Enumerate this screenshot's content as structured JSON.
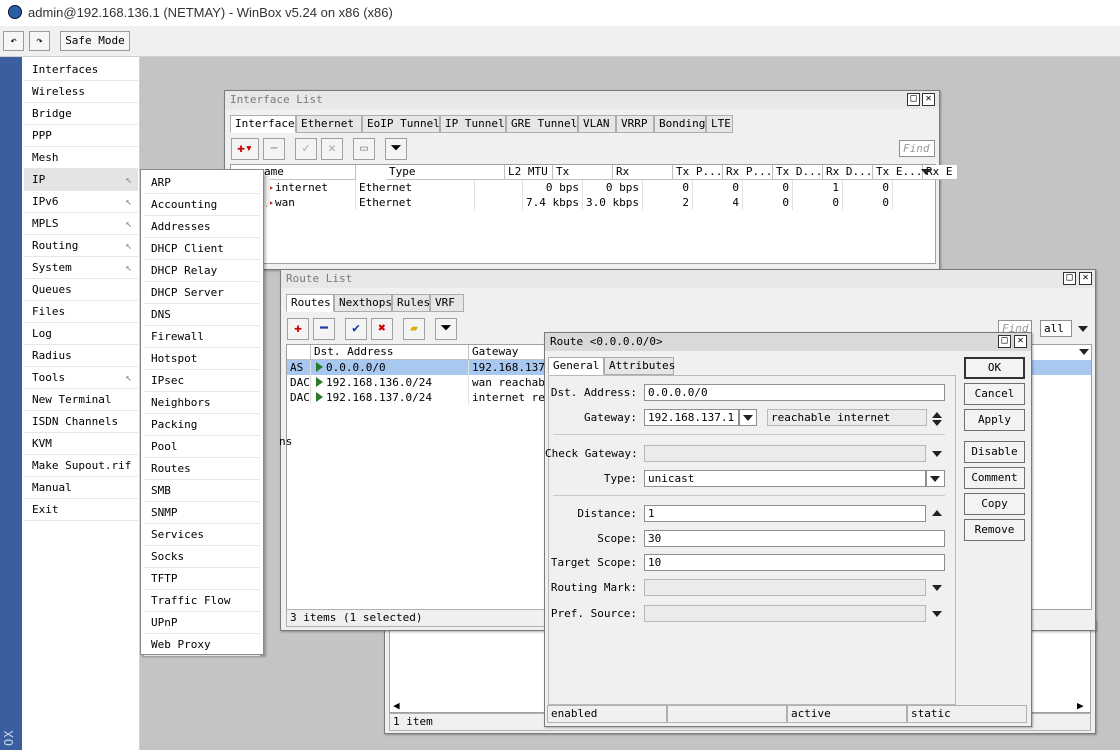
{
  "window_title": "admin@192.168.136.1 (NETMAY) - WinBox v5.24 on x86 (x86)",
  "toolbar": {
    "safe_mode": "Safe Mode"
  },
  "side_brand": "OX",
  "main_menu": [
    "Interfaces",
    "Wireless",
    "Bridge",
    "PPP",
    "Mesh",
    "IP",
    "IPv6",
    "MPLS",
    "Routing",
    "System",
    "Queues",
    "Files",
    "Log",
    "Radius",
    "Tools",
    "New Terminal",
    "ISDN Channels",
    "KVM",
    "Make Supout.rif",
    "Manual",
    "Exit"
  ],
  "ip_submenu": [
    "ARP",
    "Accounting",
    "Addresses",
    "DHCP Client",
    "DHCP Relay",
    "DHCP Server",
    "DNS",
    "Firewall",
    "Hotspot",
    "IPsec",
    "Neighbors",
    "Packing",
    "Pool",
    "Routes",
    "SMB",
    "SNMP",
    "Services",
    "Socks",
    "TFTP",
    "Traffic Flow",
    "UPnP",
    "Web Proxy"
  ],
  "interface_list": {
    "title": "Interface List",
    "tabs": [
      "Interface",
      "Ethernet",
      "EoIP Tunnel",
      "IP Tunnel",
      "GRE Tunnel",
      "VLAN",
      "VRRP",
      "Bonding",
      "LTE"
    ],
    "find": "Find",
    "columns": [
      "ame",
      "Type",
      "L2 MTU",
      "Tx",
      "Rx",
      "Tx P...",
      "Rx P...",
      "Tx D...",
      "Rx D...",
      "Tx E...",
      "Rx E"
    ],
    "rows": [
      [
        "internet",
        "Ethernet",
        "",
        "0 bps",
        "0 bps",
        "0",
        "0",
        "0",
        "1",
        "0"
      ],
      [
        "wan",
        "Ethernet",
        "",
        "7.4 kbps",
        "3.0 kbps",
        "2",
        "4",
        "0",
        "0",
        "0"
      ]
    ],
    "status": "1 item"
  },
  "route_list": {
    "title": "Route List",
    "tabs": [
      "Routes",
      "Nexthops",
      "Rules",
      "VRF"
    ],
    "find": "Find",
    "filter_value": "all",
    "columns": [
      "Dst. Address",
      "Gateway"
    ],
    "rows": [
      {
        "flags": "AS",
        "dst": "0.0.0.0/0",
        "gw": "192.168.137."
      },
      {
        "flags": "DAC",
        "dst": "192.168.136.0/24",
        "gw": "wan reachabl"
      },
      {
        "flags": "DAC",
        "dst": "192.168.137.0/24",
        "gw": "internet rea"
      }
    ],
    "left_fragment": "ns",
    "status": "3 items (1 selected)"
  },
  "route_dialog": {
    "title": "Route <0.0.0.0/0>",
    "tabs": [
      "General",
      "Attributes"
    ],
    "labels": {
      "dst": "Dst. Address:",
      "gateway": "Gateway:",
      "check_gateway": "Check Gateway:",
      "type": "Type:",
      "distance": "Distance:",
      "scope": "Scope:",
      "target_scope": "Target Scope:",
      "routing_mark": "Routing Mark:",
      "pref_source": "Pref. Source:"
    },
    "values": {
      "dst": "0.0.0.0/0",
      "gateway": "192.168.137.1",
      "gateway_state": "reachable internet",
      "check_gateway": "",
      "type": "unicast",
      "distance": "1",
      "scope": "30",
      "target_scope": "10",
      "routing_mark": "",
      "pref_source": ""
    },
    "buttons": [
      "OK",
      "Cancel",
      "Apply",
      "Disable",
      "Comment",
      "Copy",
      "Remove"
    ],
    "status": [
      "enabled",
      "",
      "active",
      "static"
    ]
  }
}
